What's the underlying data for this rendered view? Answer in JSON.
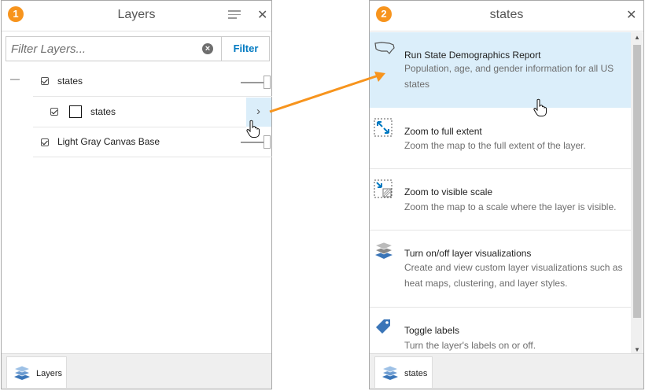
{
  "layers_panel": {
    "badge": "1",
    "title": "Layers",
    "close": "✕",
    "filter_placeholder": "Filter Layers...",
    "clear": "×",
    "filter_button": "Filter",
    "collapse": "—",
    "layers": [
      {
        "label": "states",
        "checked": true
      },
      {
        "label": "states",
        "checked": true,
        "sublayer": true
      },
      {
        "label": "Light Gray Canvas Base",
        "checked": true
      }
    ],
    "chevron": "›",
    "tab_label": "Layers"
  },
  "states_panel": {
    "badge": "2",
    "title": "states",
    "close": "✕",
    "items": [
      {
        "title": "Run State Demographics Report",
        "desc": "Population, age, and gender information for all US states",
        "icon": "us-map-icon"
      },
      {
        "title": "Zoom to full extent",
        "desc": "Zoom the map to the full extent of the layer.",
        "icon": "full-extent-icon"
      },
      {
        "title": "Zoom to visible scale",
        "desc": "Zoom the map to a scale where the layer is visible.",
        "icon": "visible-scale-icon"
      },
      {
        "title": "Turn on/off layer visualizations",
        "desc": "Create and view custom layer visualizations such as heat maps, clustering, and layer styles.",
        "icon": "layers-icon"
      },
      {
        "title": "Toggle labels",
        "desc": "Turn the layer's labels on or off.",
        "icon": "label-tag-icon"
      }
    ],
    "scroll_up": "▲",
    "scroll_down": "▼",
    "tab_label": "states"
  },
  "colors": {
    "badge": "#f7941d",
    "accent": "#0079c1",
    "highlight": "#dbeefa",
    "arrow": "#f7941d"
  }
}
